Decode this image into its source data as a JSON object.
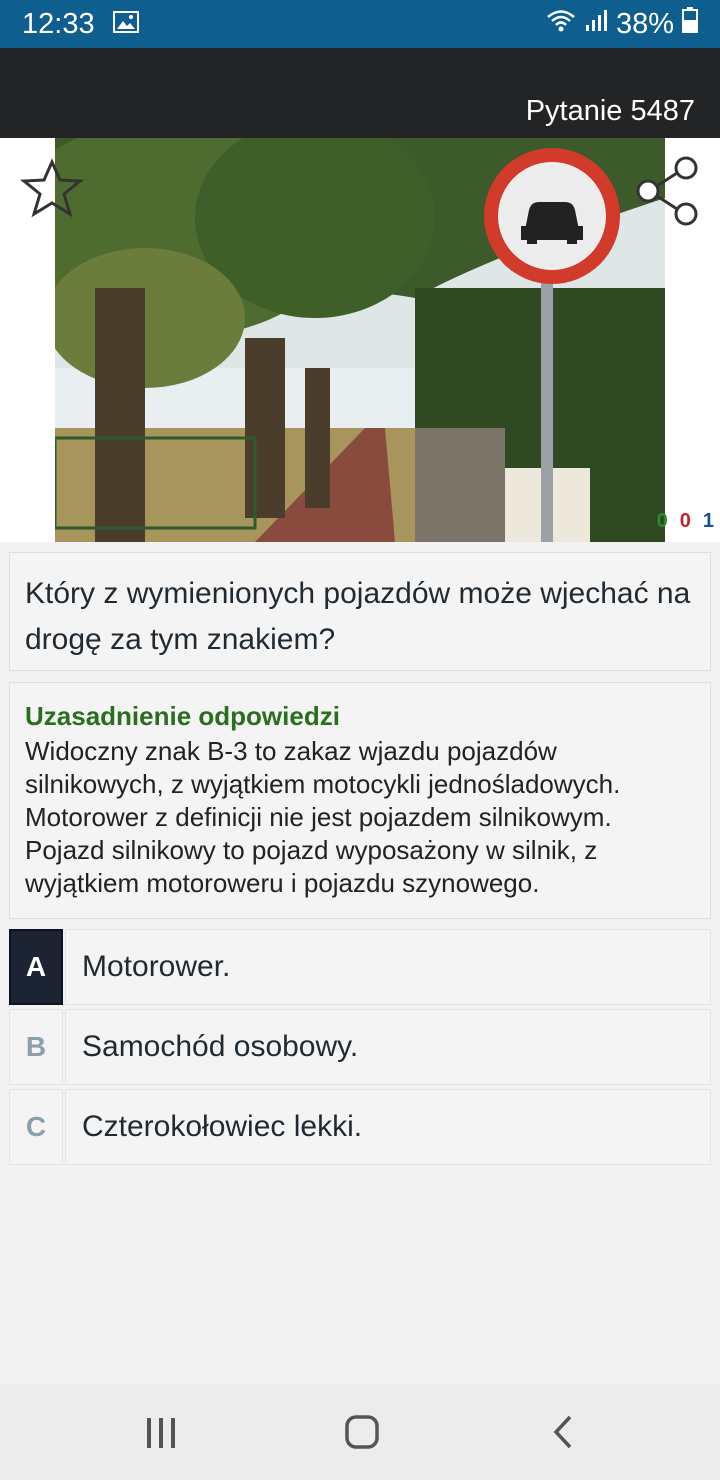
{
  "status_bar": {
    "time": "12:33",
    "battery": "38%"
  },
  "header": {
    "question_number": "Pytanie 5487"
  },
  "stats": {
    "a": "0",
    "b": "0",
    "c": "1"
  },
  "question": {
    "text": "Który z wymienionych pojazdów może wjechać na drogę za tym znakiem?"
  },
  "explanation": {
    "title": "Uzasadnienie odpowiedzi",
    "text": "Widoczny znak B-3 to zakaz wjazdu pojazdów silnikowych, z wyjątkiem motocykli jednośladowych. Motorower z definicji nie jest pojazdem silnikowym. Pojazd silnikowy to pojazd wyposażony w silnik, z wyjątkiem motoroweru i pojazdu szynowego."
  },
  "answers": [
    {
      "letter": "A",
      "text": "Motorower.",
      "selected": true
    },
    {
      "letter": "B",
      "text": "Samochód osobowy.",
      "selected": false
    },
    {
      "letter": "C",
      "text": "Czterokołowiec lekki.",
      "selected": false
    }
  ],
  "colors": {
    "status_bar": "#0e5f8f",
    "app_bar": "#222426",
    "explanation_title": "#2b6e1f",
    "selected_answer": "#1c2433"
  }
}
